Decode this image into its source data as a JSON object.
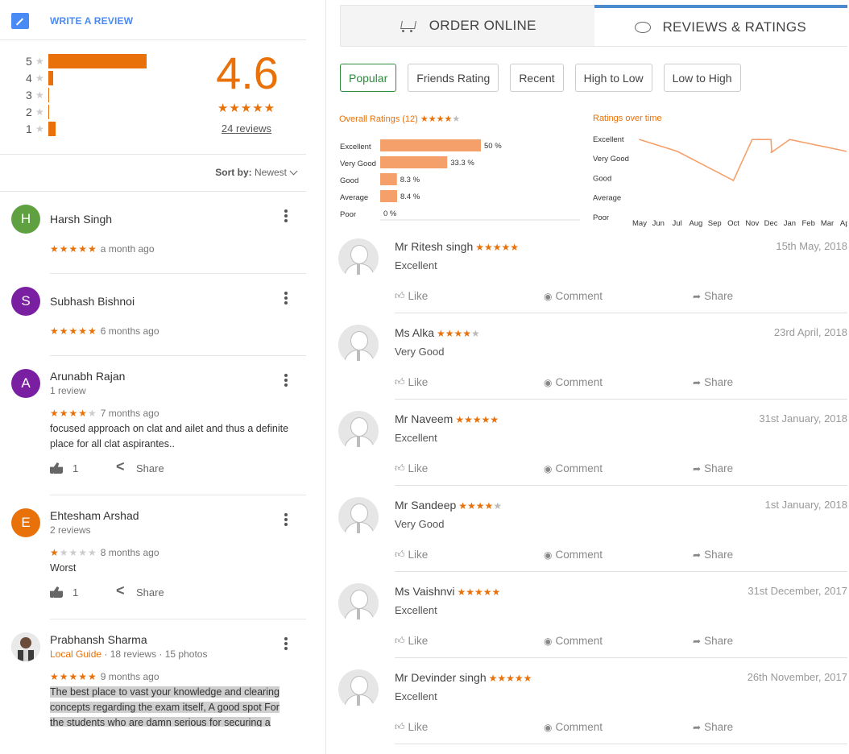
{
  "left": {
    "write_review": "WRITE A REVIEW",
    "distribution": [
      {
        "stars": "5",
        "fraction": 0.8
      },
      {
        "stars": "4",
        "fraction": 0.04
      },
      {
        "stars": "3",
        "fraction": 0.005
      },
      {
        "stars": "2",
        "fraction": 0.005
      },
      {
        "stars": "1",
        "fraction": 0.06
      }
    ],
    "score": "4.6",
    "score_stars": "★★★★★",
    "reviews_link": "24 reviews",
    "sort_label": "Sort by:",
    "sort_value": "Newest",
    "reviews": [
      {
        "initial": "H",
        "color": "#5fa040",
        "name": "Harsh Singh",
        "stars": "★★★★★",
        "stars_off": "",
        "time": "a month ago"
      },
      {
        "initial": "S",
        "color": "#7b1fa2",
        "name": "Subhash Bishnoi",
        "stars": "★★★★★",
        "stars_off": "",
        "time": "6 months ago"
      },
      {
        "initial": "A",
        "color": "#7b1fa2",
        "name": "Arunabh Rajan",
        "sub": "1 review",
        "stars": "★★★★",
        "stars_off": "★",
        "time": "7 months ago",
        "text": "focused approach on clat and ailet and thus a definite place for all clat aspirantes..",
        "likes": "1",
        "share": "Share"
      },
      {
        "initial": "E",
        "color": "#e8710a",
        "name": "Ehtesham Arshad",
        "sub": "2 reviews",
        "stars": "★",
        "stars_off": "★★★★",
        "time": "8 months ago",
        "text": "Worst",
        "likes": "1",
        "share": "Share"
      },
      {
        "name": "Prabhansh Sharma",
        "guide": "Local Guide",
        "sub": "· 18 reviews · 15 photos",
        "stars": "★★★★★",
        "stars_off": "",
        "time": "9 months ago",
        "text": "The best place to vast your knowledge and clearing concepts regarding the exam itself, A good spot For the students who are damn serious for securing a"
      }
    ]
  },
  "right": {
    "tab_order": "ORDER ONLINE",
    "tab_reviews": "REVIEWS & RATINGS",
    "filters": [
      "Popular",
      "Friends Rating",
      "Recent",
      "High to Low",
      "Low to High"
    ],
    "overall_title": "Overall Ratings (12)",
    "overall_stars": "★★★★",
    "overall_stars_off": "★",
    "over_time_title": "Ratings over time",
    "actions": {
      "like": "Like",
      "comment": "Comment",
      "share": "Share"
    },
    "reviews": [
      {
        "name": "Mr Ritesh singh",
        "stars": "★★★★★",
        "stars_off": "",
        "date": "15th May, 2018",
        "text": "Excellent"
      },
      {
        "name": "Ms Alka",
        "stars": "★★★★",
        "stars_off": "★",
        "date": "23rd April, 2018",
        "text": "Very Good"
      },
      {
        "name": "Mr Naveem",
        "stars": "★★★★★",
        "stars_off": "",
        "date": "31st January, 2018",
        "text": "Excellent"
      },
      {
        "name": "Mr Sandeep",
        "stars": "★★★★",
        "stars_off": "★",
        "date": "1st January, 2018",
        "text": "Very Good"
      },
      {
        "name": "Ms Vaishnvi",
        "stars": "★★★★★",
        "stars_off": "",
        "date": "31st December, 2017",
        "text": "Excellent"
      },
      {
        "name": "Mr Devinder singh",
        "stars": "★★★★★",
        "stars_off": "",
        "date": "26th November, 2017",
        "text": "Excellent"
      }
    ]
  },
  "chart_data": [
    {
      "type": "bar",
      "categories": [
        "Excellent",
        "Very Good",
        "Good",
        "Average",
        "Poor"
      ],
      "values": [
        50,
        33.3,
        8.3,
        8.4,
        0
      ],
      "value_labels": [
        "50 %",
        "33.3 %",
        "8.3 %",
        "8.4 %",
        "0 %"
      ],
      "xlim": [
        0,
        100
      ],
      "color": "#f5a06a"
    },
    {
      "type": "line",
      "categories": [
        "May",
        "Jun",
        "Jul",
        "Aug",
        "Sep",
        "Oct",
        "Nov",
        "Dec",
        "Jan",
        "Feb",
        "Mar",
        "Apr"
      ],
      "y_categories": [
        "Excellent",
        "Very Good",
        "Good",
        "Average",
        "Poor"
      ],
      "points": [
        {
          "x": "May",
          "y": 4.95
        },
        {
          "x": "Jul",
          "y": 4.35
        },
        {
          "x": "Oct",
          "y": 2.85
        },
        {
          "x": "Nov",
          "y": 4.95
        },
        {
          "x": "Dec",
          "y": 4.95
        },
        {
          "x": "Dec",
          "y": 4.3
        },
        {
          "x": "Jan",
          "y": 4.95
        },
        {
          "x": "Apr",
          "y": 4.35
        }
      ],
      "color": "#f5a06a"
    }
  ]
}
